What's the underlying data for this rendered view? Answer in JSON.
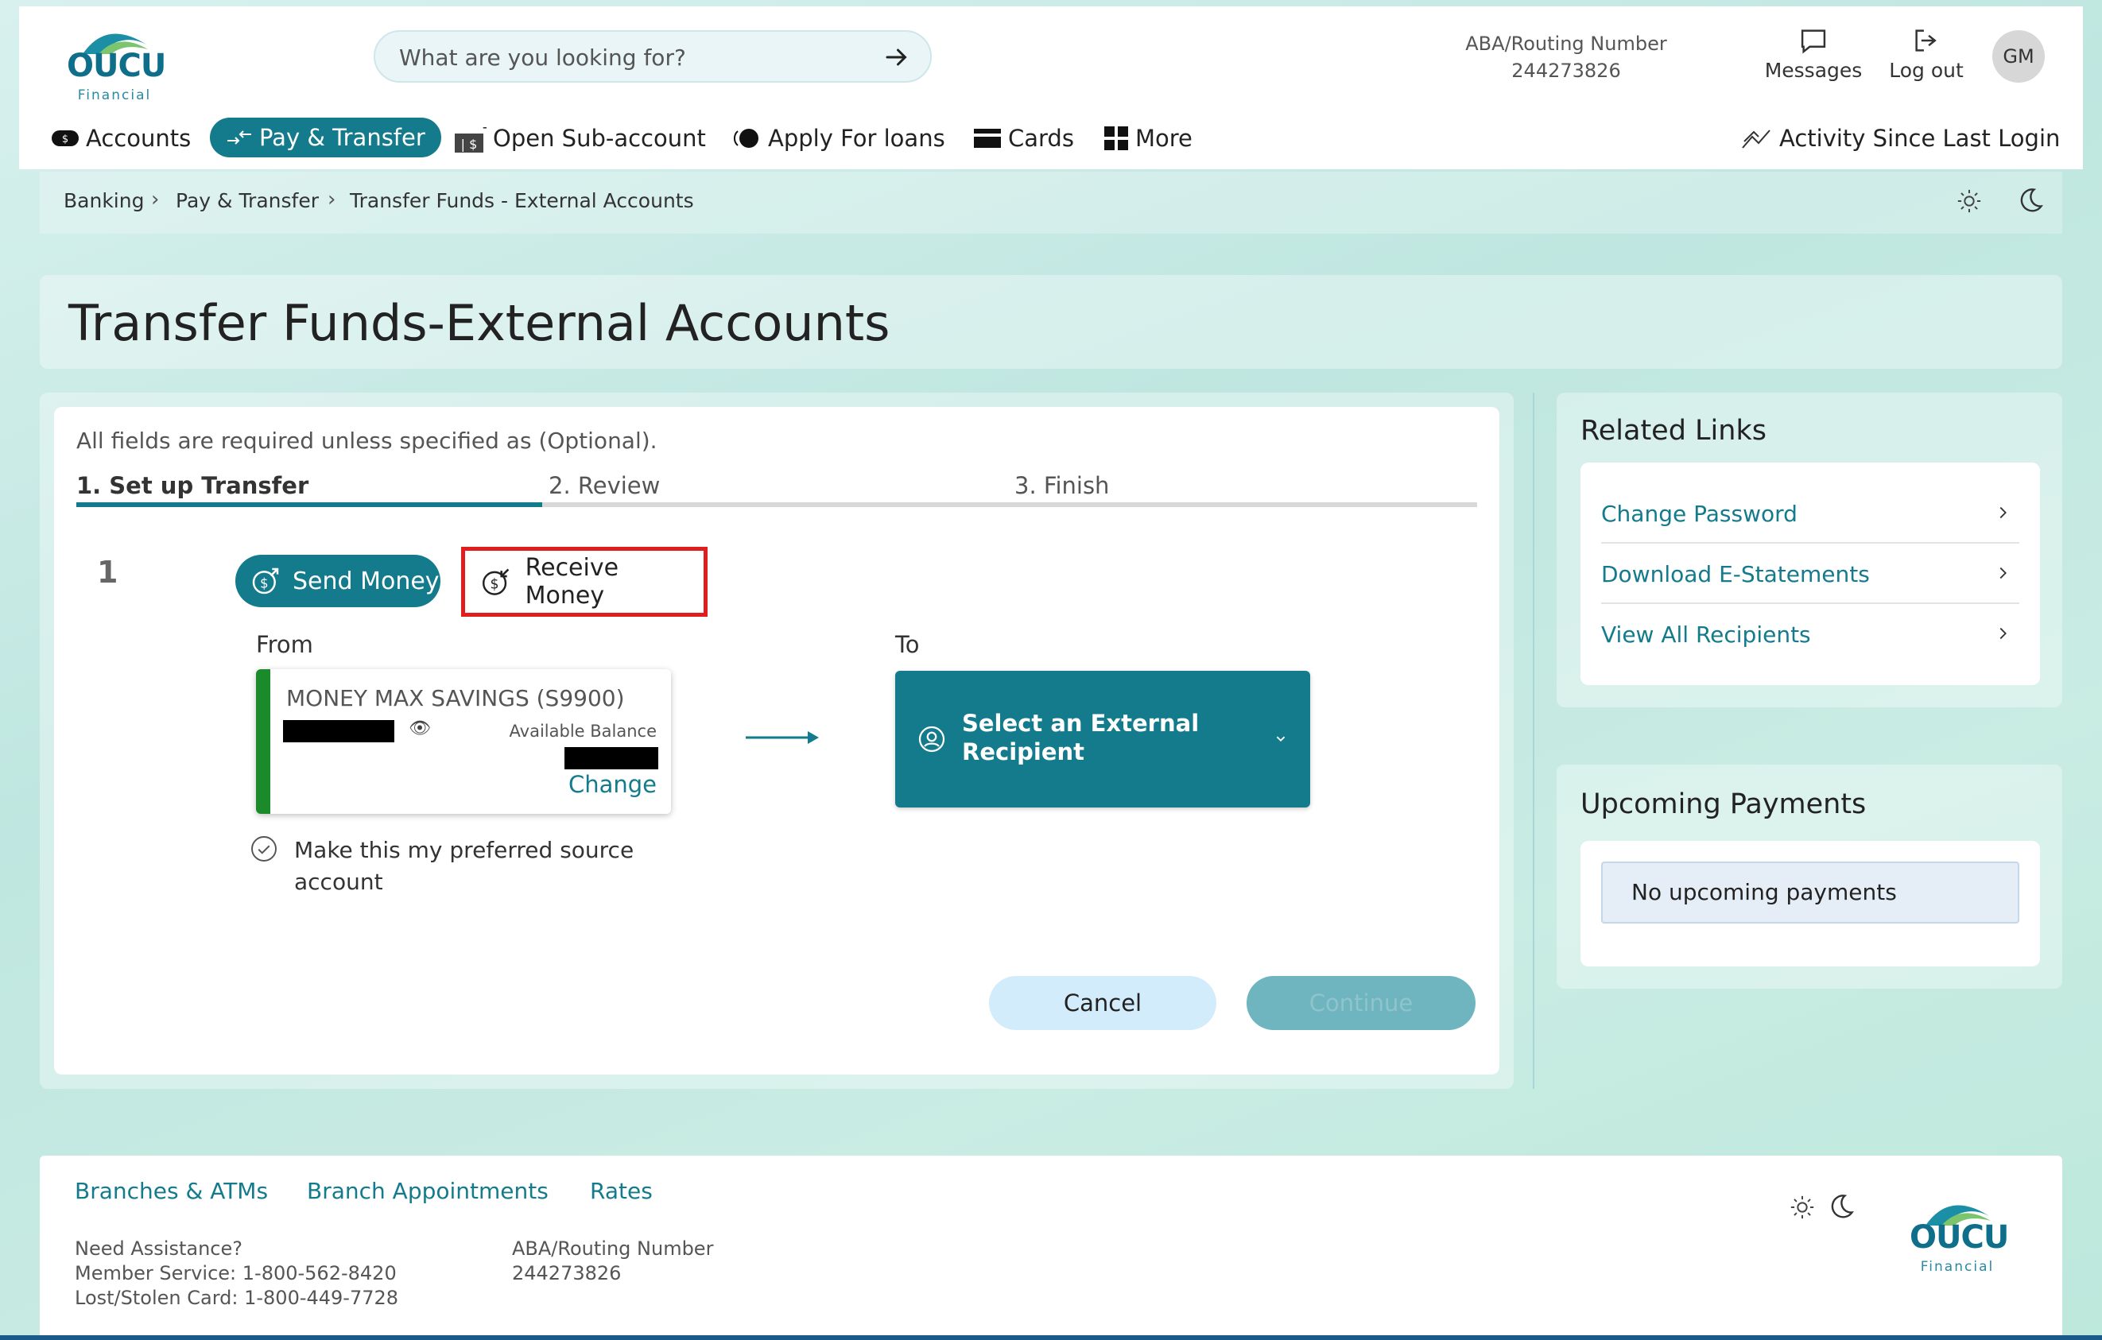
{
  "header": {
    "logo": {
      "word": "OUCU",
      "sub": "Financial"
    },
    "search_placeholder": "What are you looking for?",
    "routing_label": "ABA/Routing Number",
    "routing_number": "244273826",
    "messages_label": "Messages",
    "logout_label": "Log out",
    "avatar_initials": "GM"
  },
  "nav": {
    "accounts": "Accounts",
    "pay_transfer": "Pay & Transfer",
    "open_sub": "Open Sub-account",
    "apply_loans": "Apply For loans",
    "cards": "Cards",
    "more": "More",
    "activity": "Activity Since Last Login"
  },
  "breadcrumb": [
    "Banking",
    "Pay & Transfer",
    "Transfer Funds - External Accounts"
  ],
  "page_title": "Transfer Funds-External Accounts",
  "form": {
    "required_note": "All fields are required unless specified as (Optional).",
    "steps": [
      "1. Set up Transfer",
      "2. Review",
      "3. Finish"
    ],
    "section_number": "1",
    "send_money": "Send Money",
    "receive_money": "Receive Money",
    "from_label": "From",
    "to_label": "To",
    "from_account": {
      "name": "MONEY MAX SAVINGS (S9900)",
      "available_label": "Available Balance",
      "change_label": "Change"
    },
    "preferred_label": "Make this my preferred source account",
    "to_placeholder": "Select an External Recipient",
    "cancel": "Cancel",
    "continue": "Continue"
  },
  "related_links": {
    "heading": "Related Links",
    "items": [
      "Change Password",
      "Download E-Statements",
      "View All Recipients"
    ]
  },
  "upcoming": {
    "heading": "Upcoming Payments",
    "empty": "No upcoming payments"
  },
  "footer": {
    "links": [
      "Branches & ATMs",
      "Branch Appointments",
      "Rates"
    ],
    "assist_heading": "Need Assistance?",
    "member_service": "Member Service: 1-800-562-8420",
    "lost_card": "Lost/Stolen Card: 1-800-449-7728",
    "routing_label": "ABA/Routing Number",
    "routing_number": "244273826"
  },
  "colors": {
    "brand": "#137b8c",
    "highlight_border": "#e01e1e",
    "account_bar": "#1a8a2a"
  }
}
